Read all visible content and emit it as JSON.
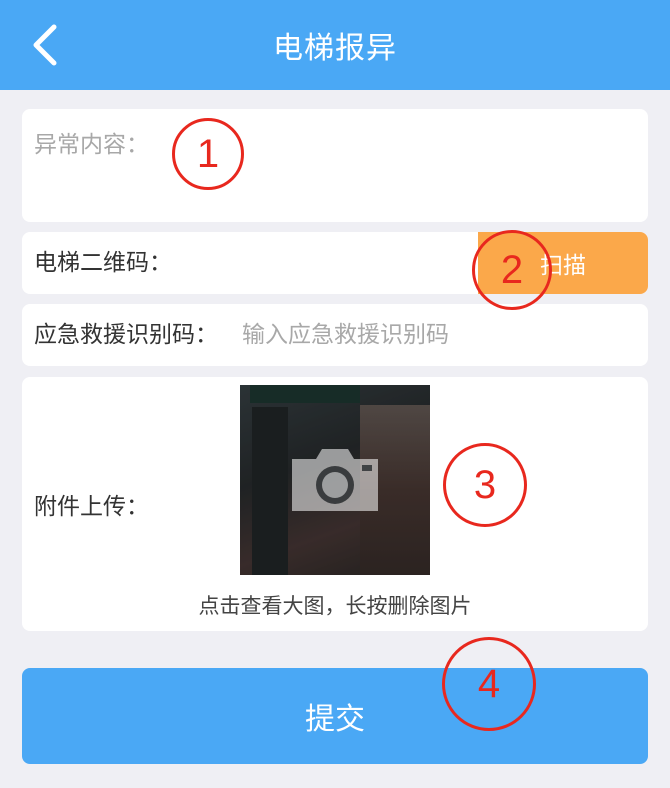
{
  "header": {
    "title": "电梯报异",
    "back_icon": "chevron-left-icon",
    "color": "#4aa8f5"
  },
  "exception": {
    "label": "异常内容："
  },
  "qr": {
    "label": "电梯二维码：",
    "scan_label": "扫描",
    "scan_color": "#fba84a"
  },
  "rescue": {
    "label": "应急救援识别码：",
    "placeholder": "输入应急救援识别码",
    "value": ""
  },
  "upload": {
    "label": "附件上传：",
    "camera_icon": "camera-icon",
    "hint": "点击查看大图，长按删除图片"
  },
  "submit": {
    "label": "提交"
  },
  "markers": [
    "1",
    "2",
    "3",
    "4"
  ],
  "marker_color": "#e8281e"
}
